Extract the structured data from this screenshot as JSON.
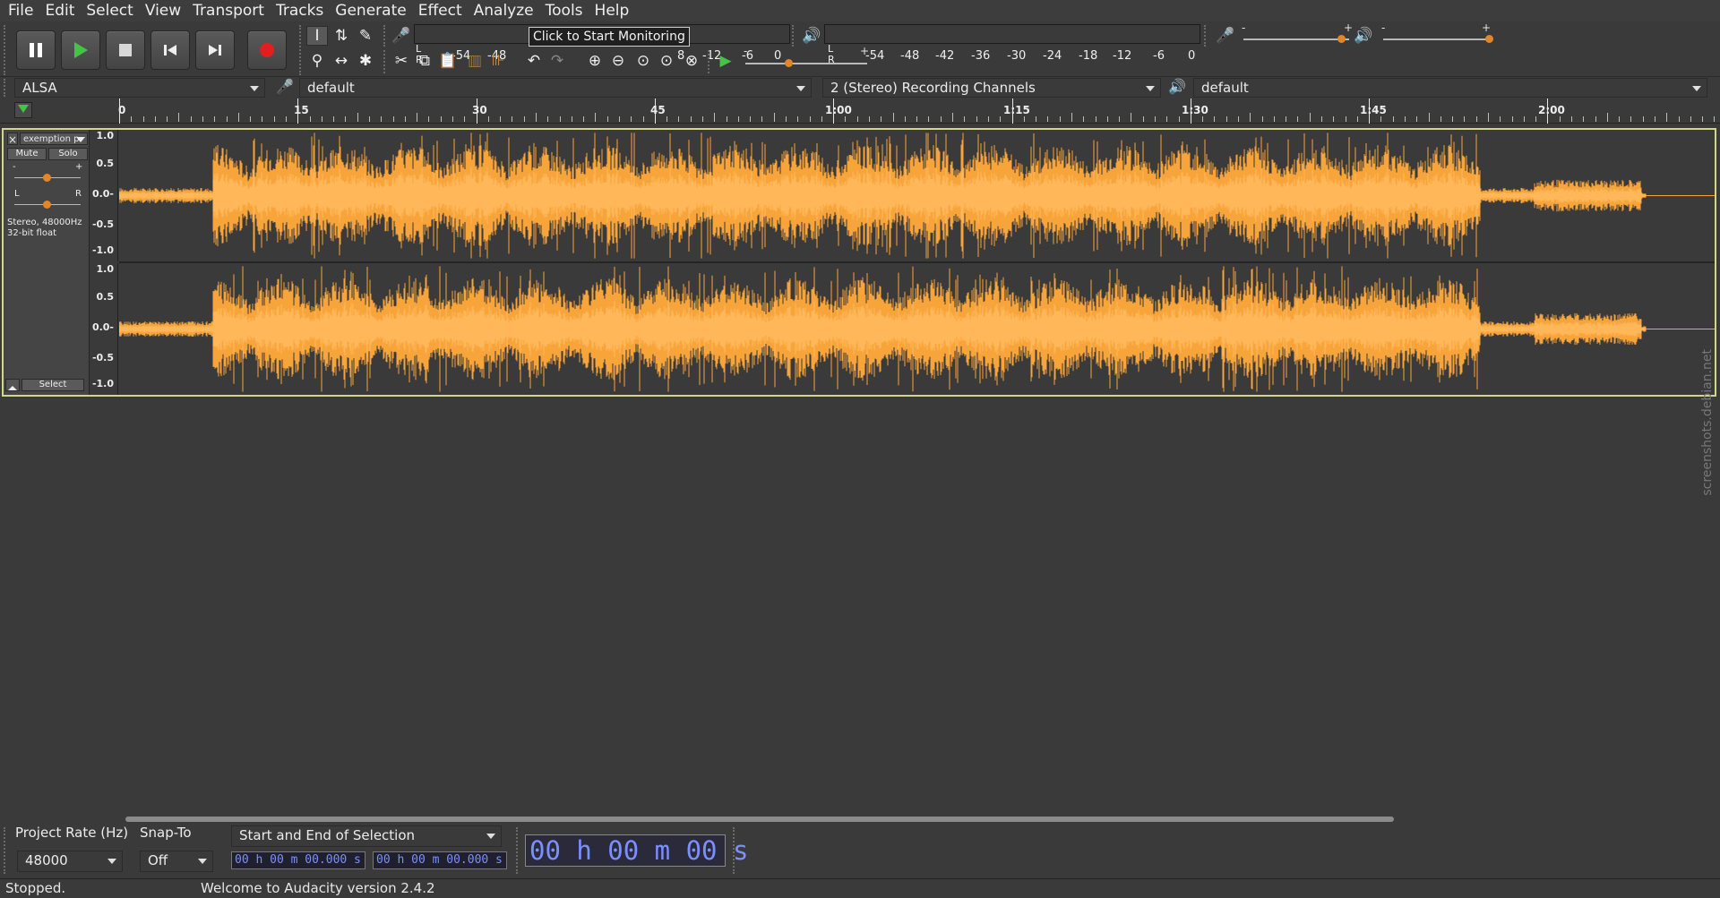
{
  "menu": [
    "File",
    "Edit",
    "Select",
    "View",
    "Transport",
    "Tracks",
    "Generate",
    "Effect",
    "Analyze",
    "Tools",
    "Help"
  ],
  "transport": {
    "pause": "pause-icon",
    "play": "play-icon",
    "stop": "stop-icon",
    "skip_start": "skip-to-start-icon",
    "skip_end": "skip-to-end-icon",
    "record": "record-icon"
  },
  "tools": [
    "selection-tool",
    "envelope-tool",
    "draw-tool",
    "zoom-tool",
    "timeshift-tool",
    "multi-tool"
  ],
  "recording_meter": {
    "ticks_before": [
      "-54",
      "-48"
    ],
    "ticks_after": [
      "8",
      "-12",
      "-6",
      "0"
    ],
    "tooltip": "Click to Start Monitoring",
    "channel_labels": [
      "L",
      "R"
    ]
  },
  "playback_meter": {
    "ticks": [
      "-54",
      "-48",
      "-42",
      "-36",
      "-30",
      "-24",
      "-18",
      "-12",
      "-6",
      "0"
    ],
    "channel_labels": [
      "L",
      "R"
    ]
  },
  "mixer": {
    "min_symbol": "-",
    "max_symbol": "+",
    "recording_volume": 0.92,
    "playback_volume": 1.0
  },
  "play_at_speed": {
    "min_symbol": "-",
    "max_symbol": "+",
    "speed_position": 0.35
  },
  "device": {
    "host": "ALSA",
    "recording_device": "default",
    "recording_channels": "2 (Stereo) Recording Channels",
    "playback_device": "default"
  },
  "timeline": {
    "labels": [
      "0",
      "15",
      "30",
      "45",
      "1:00",
      "1:15",
      "1:30",
      "1:45",
      "2:00"
    ]
  },
  "track": {
    "name": "exemption p",
    "mute": "Mute",
    "solo": "Solo",
    "gain_minus": "-",
    "gain_plus": "+",
    "pan_left": "L",
    "pan_right": "R",
    "info_line1": "Stereo, 48000Hz",
    "info_line2": "32-bit float",
    "select": "Select",
    "close": "×",
    "amplitude_labels": [
      "1.0",
      "0.5",
      "0.0-",
      "-0.5",
      "-1.0"
    ],
    "color": "#f7a43a"
  },
  "selection_toolbar": {
    "project_rate_label": "Project Rate (Hz)",
    "project_rate": "48000",
    "snap_to_label": "Snap-To",
    "snap_to": "Off",
    "selection_mode": "Start and End of Selection",
    "start_time": "00 h 00 m 00.000 s",
    "end_time": "00 h 00 m 00.000 s",
    "audio_position": "00 h 00 m 00 s"
  },
  "status": {
    "state": "Stopped.",
    "message": "Welcome to Audacity version 2.4.2"
  },
  "watermark": "screenshots.debian.net"
}
